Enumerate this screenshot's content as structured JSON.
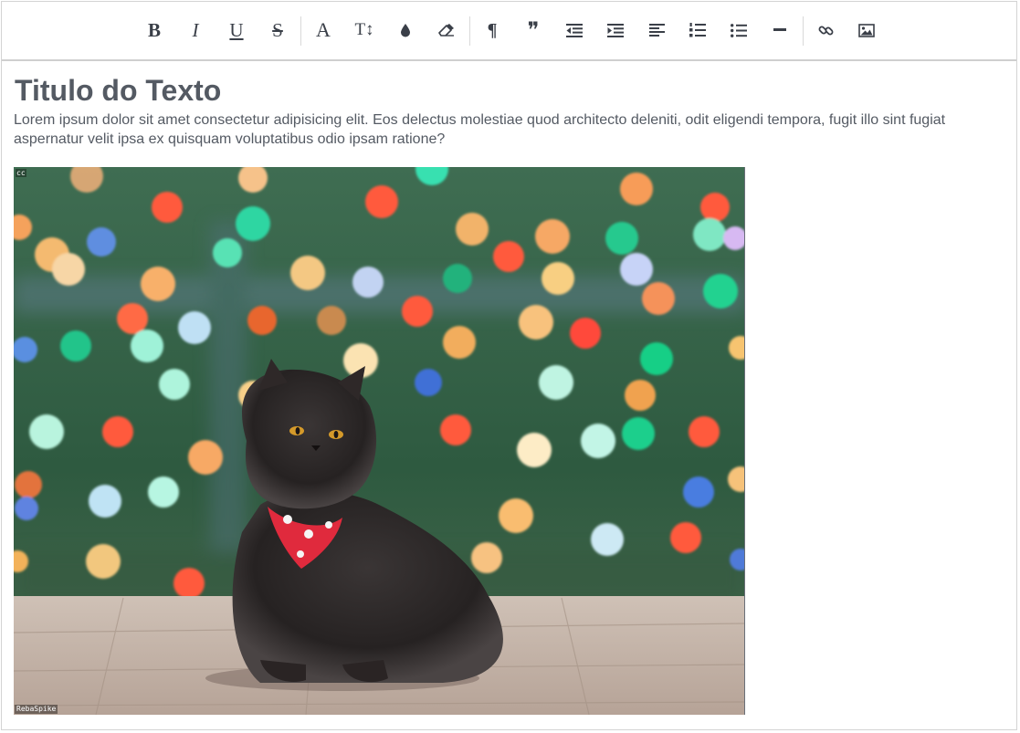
{
  "toolbar": {
    "buttons": [
      {
        "name": "bold",
        "glyph": "B",
        "icon": "bold-icon"
      },
      {
        "name": "italic",
        "glyph": "I",
        "icon": "italic-icon"
      },
      {
        "name": "underline",
        "glyph": "U",
        "icon": "underline-icon"
      },
      {
        "name": "strikethrough",
        "glyph": "S",
        "icon": "strikethrough-icon"
      },
      {
        "name": "font",
        "glyph": "A",
        "icon": "font-icon"
      },
      {
        "name": "font-size",
        "glyph": "T↕",
        "icon": "text-height-icon"
      },
      {
        "name": "color",
        "icon": "color-drop-icon"
      },
      {
        "name": "clear-format",
        "icon": "eraser-icon"
      },
      {
        "name": "paragraph",
        "glyph": "¶",
        "icon": "paragraph-icon"
      },
      {
        "name": "quote",
        "glyph": "❞",
        "icon": "quote-icon"
      },
      {
        "name": "outdent",
        "icon": "outdent-icon"
      },
      {
        "name": "indent",
        "icon": "indent-icon"
      },
      {
        "name": "align-left",
        "icon": "align-left-icon"
      },
      {
        "name": "ordered-list",
        "icon": "ordered-list-icon"
      },
      {
        "name": "unordered-list",
        "icon": "unordered-list-icon"
      },
      {
        "name": "horizontal-rule",
        "icon": "horizontal-rule-icon"
      },
      {
        "name": "link",
        "icon": "link-icon"
      },
      {
        "name": "image",
        "icon": "image-icon"
      }
    ]
  },
  "document": {
    "title": "Titulo do Texto",
    "paragraph": "Lorem ipsum dolor sit amet consectetur adipisicing elit. Eos delectus molestiae quod architecto deleniti, odit eligendi tempora, fugit illo sint fugiat aspernatur velit ipsa ex quisquam voluptatibus odio ipsam ratione?",
    "image": {
      "watermark_top": "cc",
      "watermark_bottom": "RebaSpike"
    }
  },
  "colors": {
    "text": "#545a63",
    "icon": "#3a3f48",
    "border": "#cfcfcf"
  }
}
